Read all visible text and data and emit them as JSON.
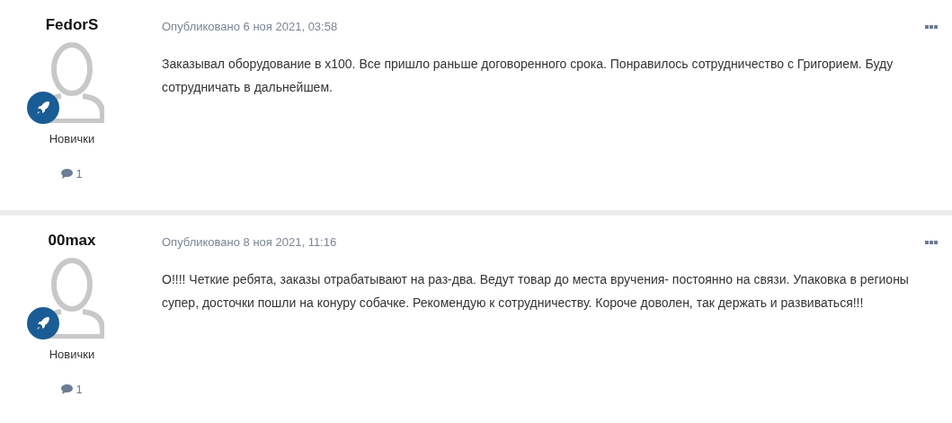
{
  "posts": [
    {
      "author": "FedorS",
      "rank": "Новички",
      "post_count": "1",
      "date": "Опубликовано 6 ноя 2021, 03:58",
      "text": "Заказывал оборудование в x100. Все пришло раньше договоренного срока. Понравилось сотрудничество с Григорием. Буду сотрудничать в дальнейшем."
    },
    {
      "author": "00max",
      "rank": "Новички",
      "post_count": "1",
      "date": "Опубликовано 8 ноя 2021, 11:16",
      "text": "О!!!! Четкие ребята, заказы отрабатывают на раз-два. Ведут товар до места вручения- постоянно на связи. Упаковка в регионы супер, досточки пошли на конуру собачке. Рекомендую к сотрудничеству. Короче доволен, так держать и развиваться!!!"
    }
  ]
}
